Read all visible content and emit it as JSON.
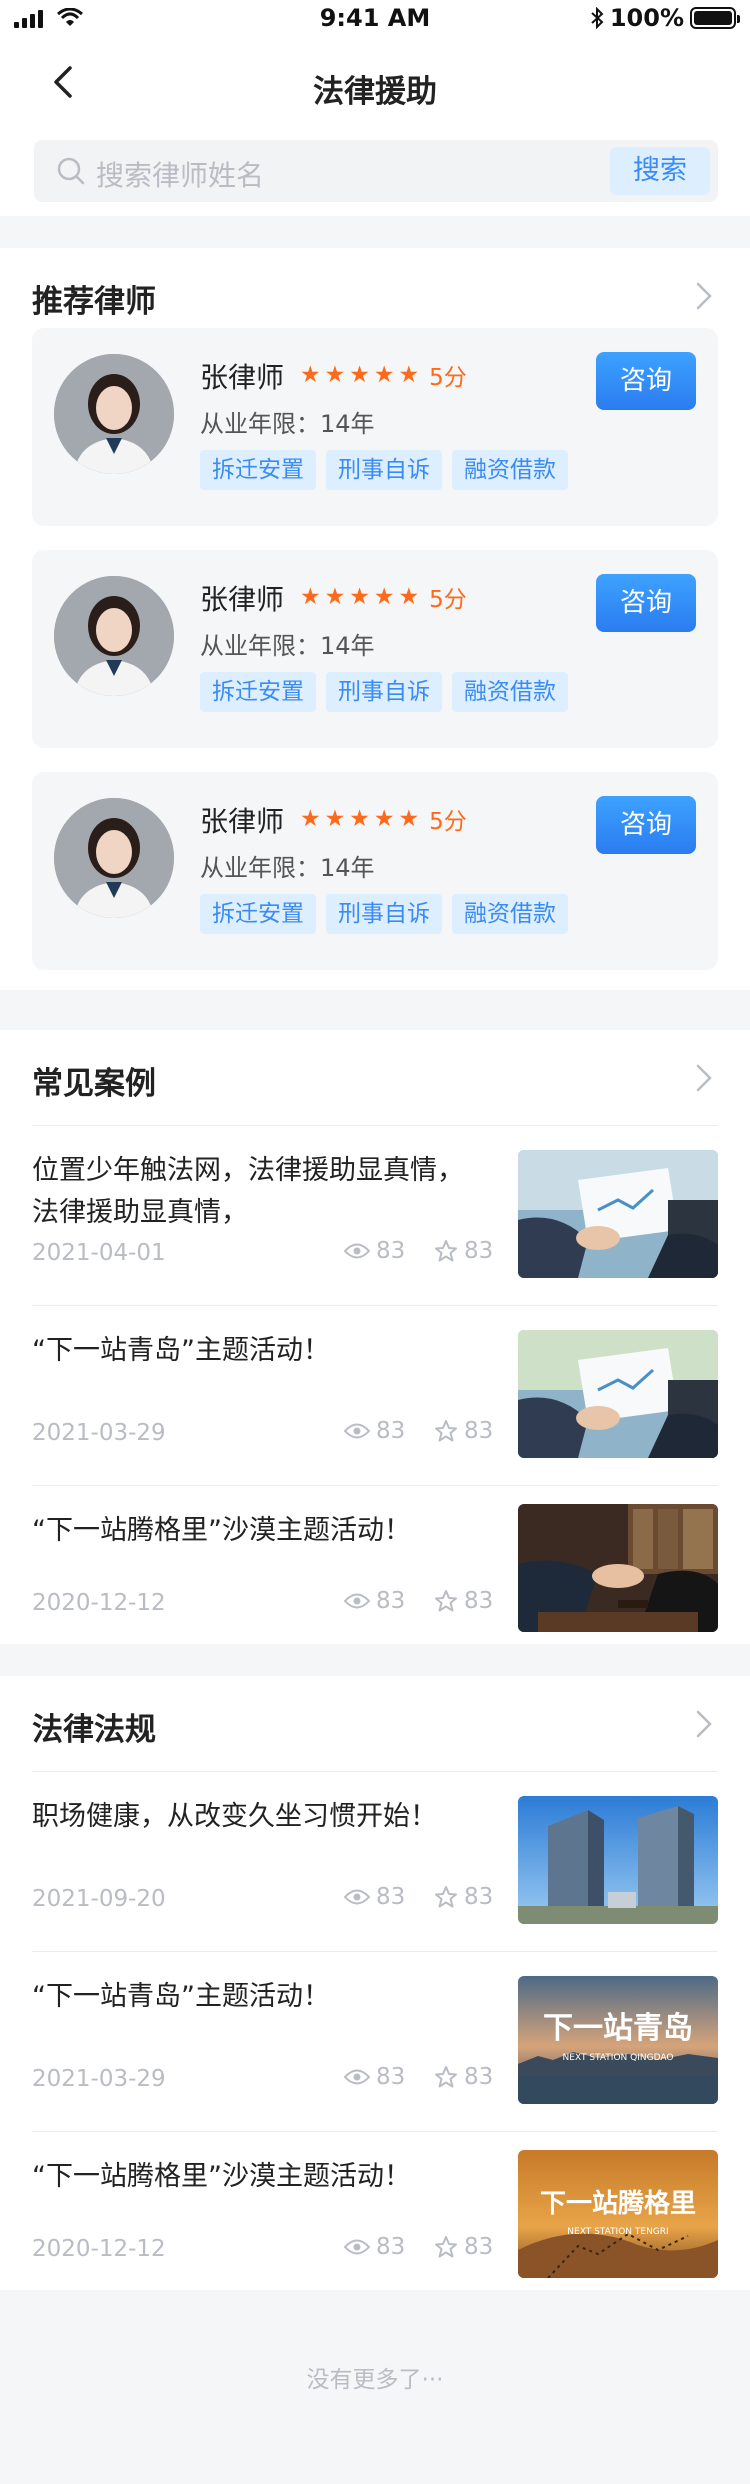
{
  "status": {
    "time": "9:41 AM",
    "battery": "100%"
  },
  "nav": {
    "title": "法律援助"
  },
  "search": {
    "placeholder": "搜索律师姓名",
    "button": "搜索"
  },
  "lawyers_section": {
    "title": "推荐律师",
    "items": [
      {
        "name": "张律师",
        "rating": 5,
        "score": "5分",
        "years_label": "从业年限：",
        "years": "14年",
        "tags": [
          "拆迁安置",
          "刑事自诉",
          "融资借款"
        ],
        "button": "咨询"
      },
      {
        "name": "张律师",
        "rating": 5,
        "score": "5分",
        "years_label": "从业年限：",
        "years": "14年",
        "tags": [
          "拆迁安置",
          "刑事自诉",
          "融资借款"
        ],
        "button": "咨询"
      },
      {
        "name": "张律师",
        "rating": 5,
        "score": "5分",
        "years_label": "从业年限：",
        "years": "14年",
        "tags": [
          "拆迁安置",
          "刑事自诉",
          "融资借款"
        ],
        "button": "咨询"
      }
    ]
  },
  "cases_section": {
    "title": "常见案例",
    "items": [
      {
        "title": "位置少年触法网，法律援助显真情，法律援助显真情，",
        "date": "2021-04-01",
        "views": "83",
        "stars": "83"
      },
      {
        "title": "“下一站青岛”主题活动！",
        "date": "2021-03-29",
        "views": "83",
        "stars": "83"
      },
      {
        "title": "“下一站腾格里”沙漠主题活动！",
        "date": "2020-12-12",
        "views": "83",
        "stars": "83"
      }
    ]
  },
  "laws_section": {
    "title": "法律法规",
    "items": [
      {
        "title": "职场健康，从改变久坐习惯开始！",
        "date": "2021-09-20",
        "views": "83",
        "stars": "83"
      },
      {
        "title": "“下一站青岛”主题活动！",
        "date": "2021-03-29",
        "views": "83",
        "stars": "83",
        "img_text": "下一站青岛",
        "img_sub": "NEXT STATION QINGDAO"
      },
      {
        "title": "“下一站腾格里”沙漠主题活动！",
        "date": "2020-12-12",
        "views": "83",
        "stars": "83",
        "img_text": "下一站腾格里",
        "img_sub": "NEXT STATION TENGRI"
      }
    ]
  },
  "footer": {
    "text": "没有更多了···"
  },
  "colors": {
    "accent": "#3b8cf2",
    "star": "#ff6a1a"
  }
}
